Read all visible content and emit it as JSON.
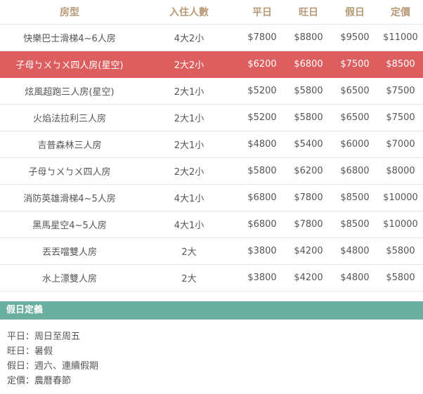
{
  "table": {
    "headers": [
      "房型",
      "入住人數",
      "平日",
      "旺日",
      "假日",
      "定價"
    ],
    "highlight_row": 1,
    "rows": [
      {
        "room": "快樂巴士滑梯4~6人房",
        "guests": "4大2小",
        "weekday": "$7800",
        "peak": "$8800",
        "holiday": "$9500",
        "list": "$11000"
      },
      {
        "room": "子母ㄅㄨㄅㄨ四人房(星空)",
        "guests": "2大2小",
        "weekday": "$6200",
        "peak": "$6800",
        "holiday": "$7500",
        "list": "$8500"
      },
      {
        "room": "炫風超跑三人房(星空)",
        "guests": "2大1小",
        "weekday": "$5200",
        "peak": "$5800",
        "holiday": "$6500",
        "list": "$7500"
      },
      {
        "room": "火焰法拉利三人房",
        "guests": "2大1小",
        "weekday": "$5200",
        "peak": "$5800",
        "holiday": "$6500",
        "list": "$7500"
      },
      {
        "room": "吉普森林三人房",
        "guests": "2大1小",
        "weekday": "$4800",
        "peak": "$5400",
        "holiday": "$6000",
        "list": "$7000"
      },
      {
        "room": "子母ㄅㄨㄅㄨ四人房",
        "guests": "2大2小",
        "weekday": "$5800",
        "peak": "$6200",
        "holiday": "$6800",
        "list": "$8000"
      },
      {
        "room": "消防英雄滑梯4~5人房",
        "guests": "4大1小",
        "weekday": "$6800",
        "peak": "$7800",
        "holiday": "$8500",
        "list": "$10000"
      },
      {
        "room": "黑馬星空4~5人房",
        "guests": "4大1小",
        "weekday": "$6800",
        "peak": "$7800",
        "holiday": "$8500",
        "list": "$10000"
      },
      {
        "room": "丟丟噹雙人房",
        "guests": "2大",
        "weekday": "$3800",
        "peak": "$4200",
        "holiday": "$4800",
        "list": "$5800"
      },
      {
        "room": "水上漂雙人房",
        "guests": "2大",
        "weekday": "$3800",
        "peak": "$4200",
        "holiday": "$4800",
        "list": "$5800"
      }
    ]
  },
  "definitions": {
    "title": "假日定義",
    "items": [
      "平日：周日至周五",
      "旺日：暑假",
      "假日：週六、連續假期",
      "定價：農曆春節"
    ]
  },
  "colors": {
    "header_text": "#b89a78",
    "highlight": "#dd5e5e",
    "section_bar": "#6aaf9f"
  }
}
